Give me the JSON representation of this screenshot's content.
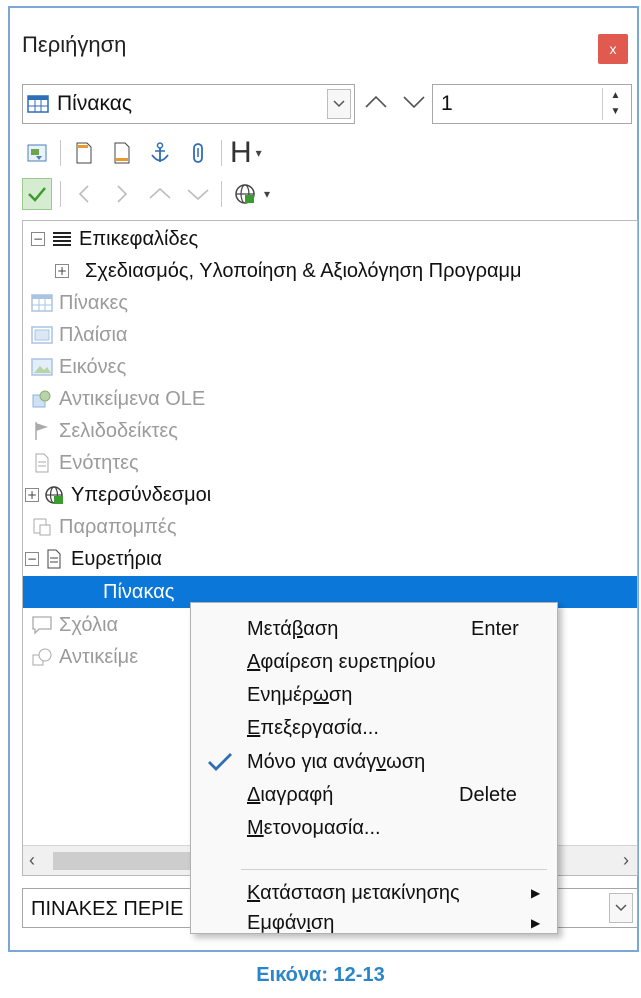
{
  "panel": {
    "title": "Περιήγηση",
    "close_label": "x"
  },
  "navigate_by": {
    "selected": "Πίνακας",
    "number_value": "1"
  },
  "toolbar": {
    "heading_label": "H"
  },
  "tree": {
    "headings": "Επικεφαλίδες",
    "heading_child": "Σχεδιασμός, Υλοποίηση & Αξιολόγηση Προγραμμ",
    "tables": "Πίνακες",
    "frames": "Πλαίσια",
    "images": "Εικόνες",
    "ole_objects": "Αντικείμενα OLE",
    "bookmarks": "Σελιδοδείκτες",
    "sections": "Ενότητες",
    "hyperlinks": "Υπερσύνδεσμοι",
    "references": "Παραπομπές",
    "indexes": "Ευρετήρια",
    "index_child": "Πίνακας",
    "comments": "Σχόλια",
    "drawing_objects": "Αντικείμε"
  },
  "document_select": "ΠΙΝΑΚΕΣ ΠΕΡΙΕ",
  "context_menu": {
    "go_to": {
      "pre": "Μετά",
      "u": "β",
      "post": "αση",
      "shortcut": "Enter"
    },
    "remove_index": {
      "pre": "",
      "u": "Α",
      "post": "φαίρεση ευρετηρίου"
    },
    "update": {
      "pre": "Ενημέρ",
      "u": "ω",
      "post": "ση"
    },
    "edit": {
      "pre": "",
      "u": "Ε",
      "post": "πεξεργασία..."
    },
    "read_only": {
      "pre": "Μόνο για ανάγ",
      "u": "ν",
      "post": "ωση"
    },
    "delete": {
      "pre": "",
      "u": "Δ",
      "post": "ιαγραφή",
      "shortcut": "Delete"
    },
    "rename": {
      "pre": "",
      "u": "Μ",
      "post": "ετονομασία..."
    },
    "drag_mode": {
      "pre": "",
      "u": "Κ",
      "post": "ατάσταση μετακίνησης"
    },
    "display": {
      "pre": "Εμφάν",
      "u": "ι",
      "post": "ση"
    }
  },
  "caption": "Εικόνα: 12-13"
}
